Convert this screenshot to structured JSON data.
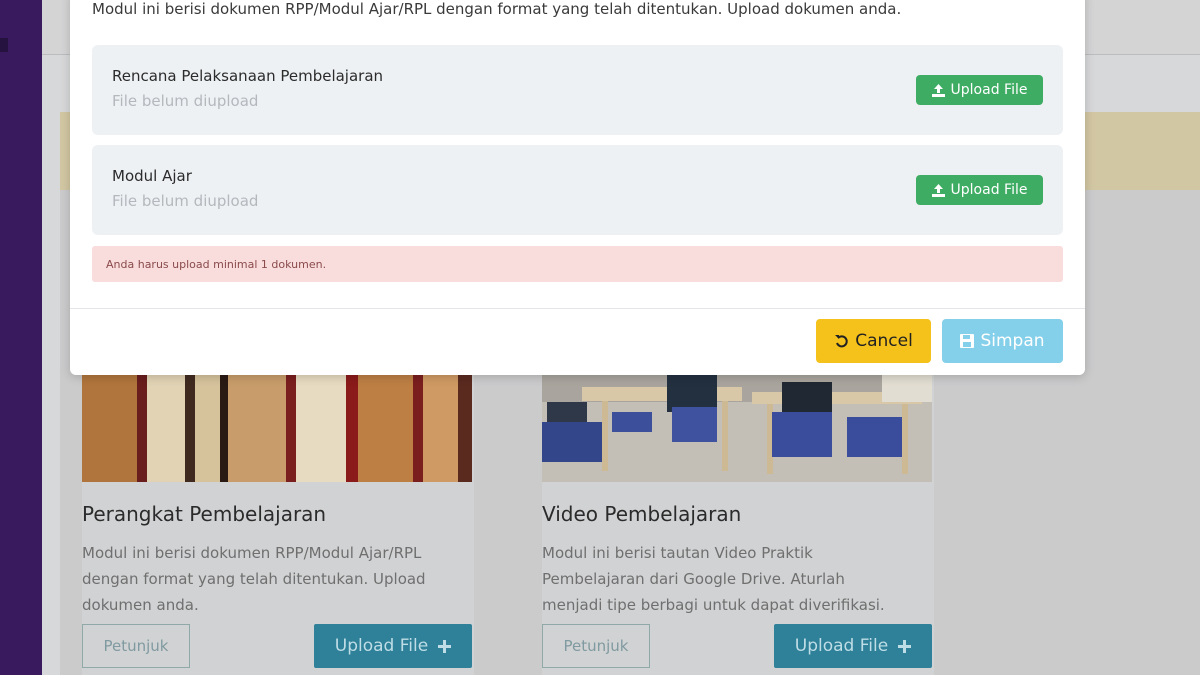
{
  "modal": {
    "intro": "Modul ini berisi dokumen RPP/Modul Ajar/RPL dengan format yang telah ditentukan. Upload dokumen anda.",
    "items": [
      {
        "name": "Rencana Pelaksanaan Pembelajaran",
        "status": "File belum diupload",
        "button": "Upload File"
      },
      {
        "name": "Modul Ajar",
        "status": "File belum diupload",
        "button": "Upload File"
      }
    ],
    "alert": "Anda harus upload minimal 1 dokumen.",
    "cancel_label": "Cancel",
    "save_label": "Simpan"
  },
  "cards": [
    {
      "title": "Perangkat Pembelajaran",
      "desc_lines": [
        "Modul ini berisi dokumen RPP/Modul Ajar/RPL",
        "dengan format yang telah ditentukan. Upload",
        "dokumen anda."
      ],
      "guide_label": "Petunjuk",
      "upload_label": "Upload File"
    },
    {
      "title": "Video Pembelajaran",
      "desc_lines": [
        "Modul ini berisi tautan Video Praktik",
        "Pembelajaran dari Google Drive. Aturlah",
        "menjadi tipe berbagi untuk dapat diverifikasi."
      ],
      "guide_label": "Petunjuk",
      "upload_label": "Upload File"
    }
  ],
  "colors": {
    "sidebar": "#3a1a5e",
    "upload_green": "#3eac63",
    "cancel_yellow": "#f4c21b",
    "save_blue": "#84cfe9",
    "alert_bg": "#f9dcdc",
    "card_primary": "#2e8198"
  },
  "icons": [
    "upload-icon",
    "undo-icon",
    "save-icon",
    "plus-icon"
  ]
}
